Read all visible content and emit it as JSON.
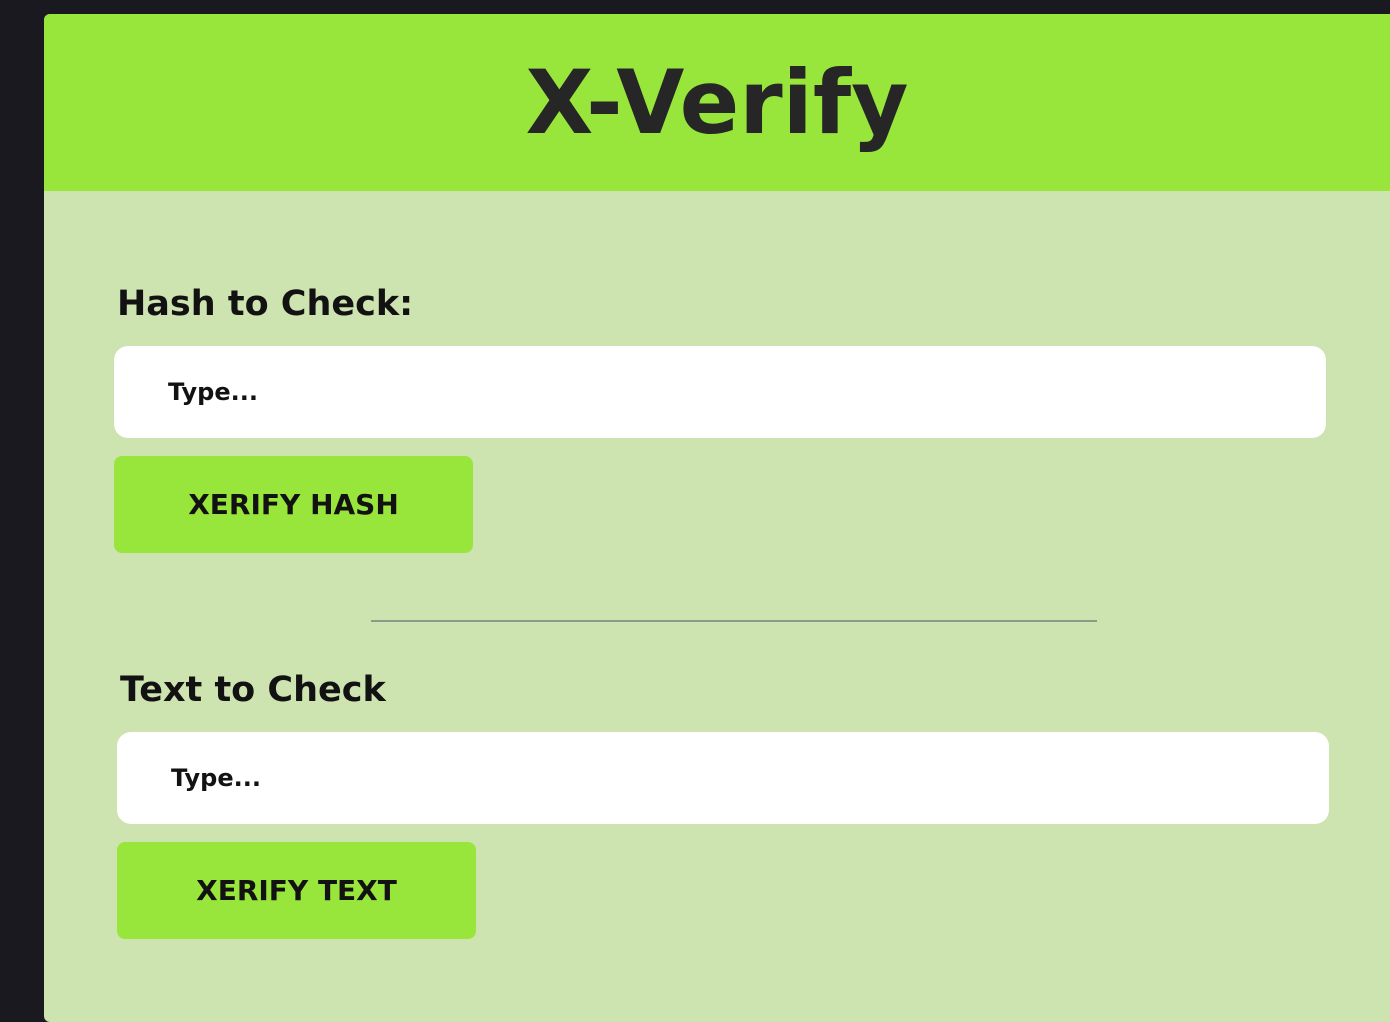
{
  "header": {
    "title": "X-Verify"
  },
  "hash_section": {
    "label": "Hash to Check:",
    "input_placeholder": "Type...",
    "button_label": "XERIFY HASH"
  },
  "text_section": {
    "label": "Text to Check",
    "input_placeholder": "Type...",
    "button_label": "XERIFY TEXT"
  },
  "colors": {
    "background": "#1b1920",
    "panel": "#cde3b0",
    "accent": "#98e63b",
    "text": "#262626"
  }
}
